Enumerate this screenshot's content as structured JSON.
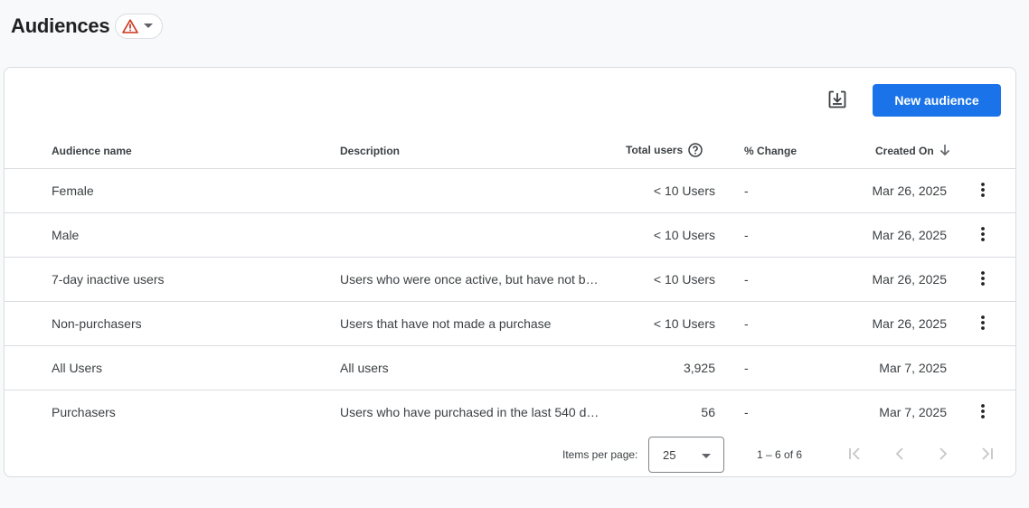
{
  "header": {
    "title": "Audiences",
    "warning_icon": "warning-triangle-icon",
    "warning_color": "#e37400",
    "dropdown_icon": "caret-down-icon"
  },
  "toolbar": {
    "download_icon": "download-icon",
    "new_audience_label": "New audience",
    "accent_color": "#1a73e8"
  },
  "table": {
    "columns": {
      "name": "Audience name",
      "description": "Description",
      "total_users": "Total users",
      "total_users_help_icon": "help-circle-icon",
      "change": "% Change",
      "created_on": "Created On",
      "sort_icon": "arrow-down-icon"
    },
    "rows": [
      {
        "name": "Female",
        "description": "",
        "total_users": "< 10 Users",
        "change": "-",
        "created_on": "Mar 26, 2025",
        "has_menu": true
      },
      {
        "name": "Male",
        "description": "",
        "total_users": "< 10 Users",
        "change": "-",
        "created_on": "Mar 26, 2025",
        "has_menu": true
      },
      {
        "name": "7-day inactive users",
        "description": "Users who were once active, but have not b…",
        "total_users": "< 10 Users",
        "change": "-",
        "created_on": "Mar 26, 2025",
        "has_menu": true
      },
      {
        "name": "Non-purchasers",
        "description": "Users that have not made a purchase",
        "total_users": "< 10 Users",
        "change": "-",
        "created_on": "Mar 26, 2025",
        "has_menu": true
      },
      {
        "name": "All Users",
        "description": "All users",
        "total_users": "3,925",
        "change": "-",
        "created_on": "Mar 7, 2025",
        "has_menu": false
      },
      {
        "name": "Purchasers",
        "description": "Users who have purchased in the last 540 d…",
        "total_users": "56",
        "change": "-",
        "created_on": "Mar 7, 2025",
        "has_menu": true
      }
    ]
  },
  "paginator": {
    "items_per_page_label": "Items per page:",
    "items_per_page_value": "25",
    "range_label": "1 – 6 of 6",
    "first_icon": "first-page-icon",
    "prev_icon": "chevron-left-icon",
    "next_icon": "chevron-right-icon",
    "last_icon": "last-page-icon"
  }
}
